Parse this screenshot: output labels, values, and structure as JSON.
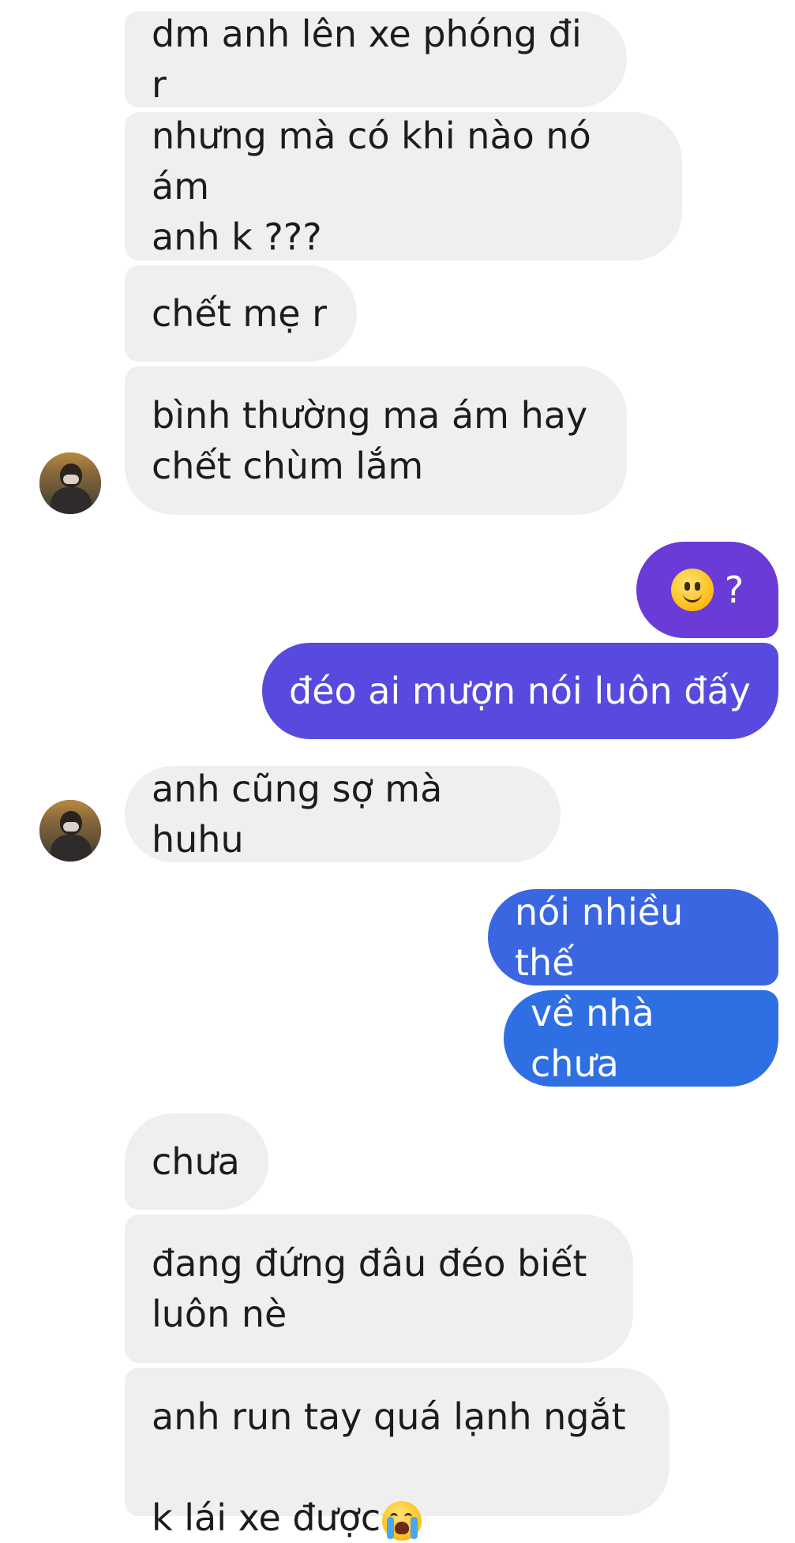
{
  "colors": {
    "incoming_bg": "#efefef",
    "outgoing_purple": "#6a3bd6",
    "outgoing_indigo": "#5849df",
    "outgoing_blue": "#3a66e2",
    "outgoing_blue2": "#2f6fe4"
  },
  "messages": [
    {
      "direction": "in",
      "text": "dm anh lên xe phóng đi r"
    },
    {
      "direction": "in",
      "text": "nhưng mà có khi nào nó ám\nanh k ???"
    },
    {
      "direction": "in",
      "text": "chết mẹ r"
    },
    {
      "direction": "in",
      "text": "bình thường ma ám hay\nchết chùm lắm"
    },
    {
      "direction": "out",
      "text": "?",
      "emoji": "slightly-smiling-face-icon"
    },
    {
      "direction": "out",
      "text": "đéo ai mượn nói luôn đấy"
    },
    {
      "direction": "in",
      "text": "anh cũng sợ mà huhu"
    },
    {
      "direction": "out",
      "text": "nói nhiều thế"
    },
    {
      "direction": "out",
      "text": "về nhà chưa"
    },
    {
      "direction": "in",
      "text": "chưa"
    },
    {
      "direction": "in",
      "text": "đang đứng đâu đéo biết\nluôn nè"
    },
    {
      "direction": "in",
      "text_line1": "anh run tay quá lạnh ngắt",
      "text_line2": "k lái xe được",
      "emoji": "loudly-crying-face-icon"
    }
  ]
}
